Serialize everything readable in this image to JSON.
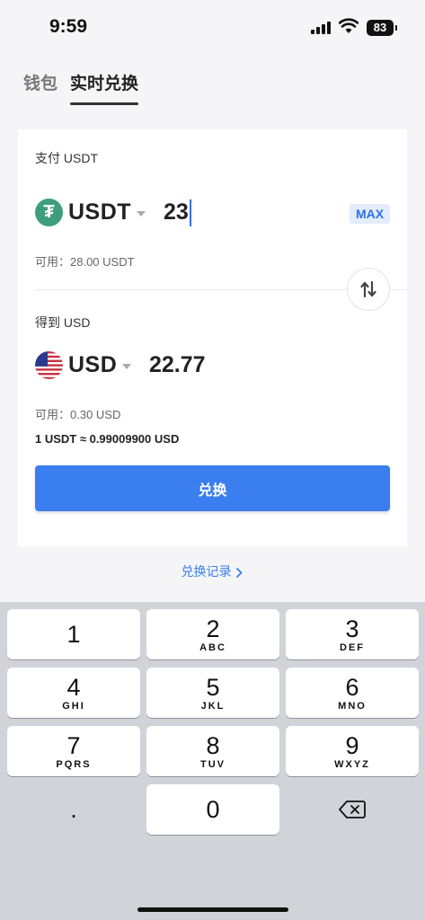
{
  "status_bar": {
    "time": "9:59",
    "battery": "83"
  },
  "tabs": [
    {
      "label": "钱包",
      "active": false
    },
    {
      "label": "实时兑换",
      "active": true
    }
  ],
  "pay": {
    "label": "支付 USDT",
    "token": "USDT",
    "token_icon": "tether-icon",
    "amount": "23",
    "max_label": "MAX",
    "available": "可用：28.00 USDT"
  },
  "receive": {
    "label": "得到 USD",
    "token": "USD",
    "token_icon": "us-flag-icon",
    "amount": "22.77",
    "available": "可用：0.30 USD"
  },
  "rate": "1 USDT ≈ 0.99009900 USD",
  "exchange_button": "兑换",
  "history_link": "兑换记录",
  "keypad": {
    "keys": [
      {
        "num": "1",
        "letters": ""
      },
      {
        "num": "2",
        "letters": "ABC"
      },
      {
        "num": "3",
        "letters": "DEF"
      },
      {
        "num": "4",
        "letters": "GHI"
      },
      {
        "num": "5",
        "letters": "JKL"
      },
      {
        "num": "6",
        "letters": "MNO"
      },
      {
        "num": "7",
        "letters": "PQRS"
      },
      {
        "num": "8",
        "letters": "TUV"
      },
      {
        "num": "9",
        "letters": "WXYZ"
      },
      {
        "num": "0",
        "letters": ""
      }
    ],
    "dot": "."
  },
  "colors": {
    "accent": "#3a7ef0",
    "tether": "#3d9e7e"
  }
}
